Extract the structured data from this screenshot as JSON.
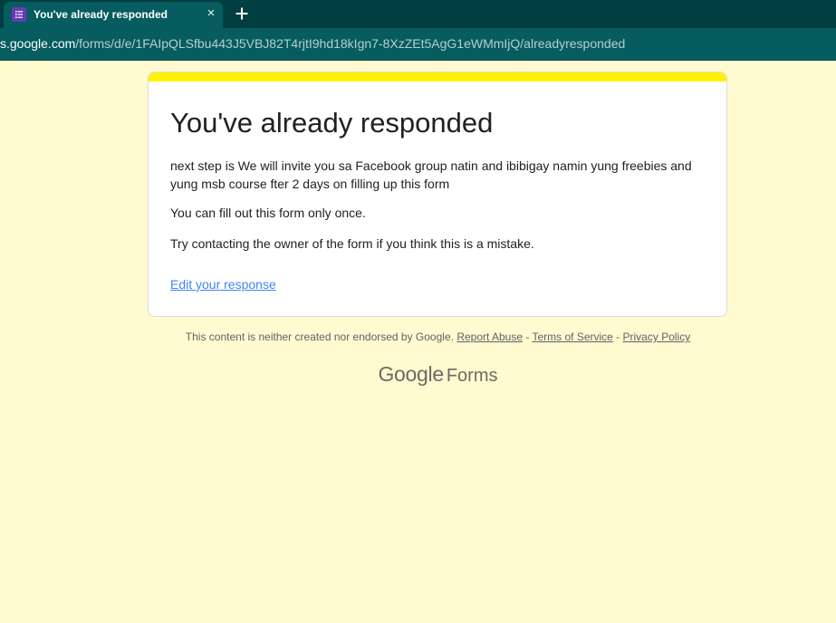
{
  "browser": {
    "tab": {
      "title": "You've already responded",
      "favicon": "google-forms-icon",
      "close_symbol": "×"
    },
    "new_tab_icon": "plus-icon",
    "url": {
      "host": "s.google.com",
      "path": "/forms/d/e/1FAIpQLSfbu443J5VBJ82T4rjtI9hd18kIgn7-8XzZEt5AgG1eWMmIjQ/alreadyresponded"
    }
  },
  "card": {
    "accent_color": "#fff200",
    "title": "You've already responded",
    "message": "next step is We will invite you sa Facebook group natin and ibibigay namin yung freebies and yung msb course fter 2 days on filling up this form",
    "once_text": "You can fill out this form only once.",
    "contact_text": "Try contacting the owner of the form if you think this is a mistake.",
    "edit_link": "Edit your response"
  },
  "footer": {
    "disclaimer": "This content is neither created nor endorsed by Google.",
    "report_abuse": "Report Abuse",
    "sep1": " - ",
    "terms": "Terms of Service",
    "sep2": " - ",
    "privacy": "Privacy Policy"
  },
  "brand": {
    "google": "Google",
    "forms": "Forms"
  },
  "colors": {
    "page_background": "#fffacf",
    "tabbar": "#003e41",
    "addressbar": "#065c5e",
    "link": "#4285f4"
  }
}
